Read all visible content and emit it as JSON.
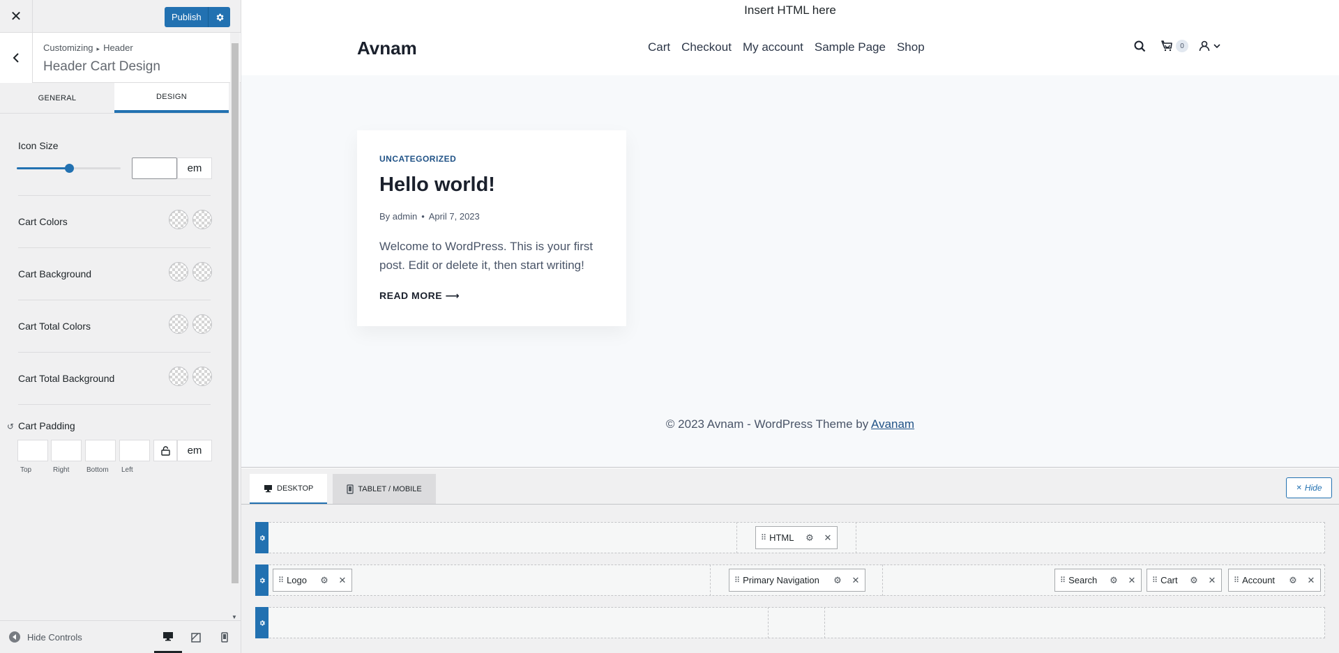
{
  "sidebar": {
    "publish_label": "Publish",
    "breadcrumb": {
      "root": "Customizing",
      "section": "Header"
    },
    "title": "Header Cart Design",
    "tabs": [
      {
        "label": "GENERAL"
      },
      {
        "label": "DESIGN"
      }
    ],
    "active_tab": "DESIGN",
    "icon_size": {
      "label": "Icon Size",
      "slider_fraction": 0.5,
      "value": "",
      "unit": "em"
    },
    "color_controls": [
      {
        "label": "Cart Colors"
      },
      {
        "label": "Cart Background"
      },
      {
        "label": "Cart Total Colors"
      },
      {
        "label": "Cart Total Background"
      }
    ],
    "padding": {
      "label": "Cart Padding",
      "unit": "em",
      "sides": [
        {
          "label": "Top"
        },
        {
          "label": "Right"
        },
        {
          "label": "Bottom"
        },
        {
          "label": "Left"
        }
      ]
    },
    "footer": {
      "hide_controls": "Hide Controls"
    }
  },
  "preview": {
    "top_html": "Insert HTML here",
    "logo": "Avnam",
    "nav": [
      "Cart",
      "Checkout",
      "My account",
      "Sample Page",
      "Shop"
    ],
    "cart_count": "0",
    "post": {
      "category": "UNCATEGORIZED",
      "title": "Hello world!",
      "author": "By admin",
      "date": "April 7, 2023",
      "excerpt": "Welcome to WordPress. This is your first post. Edit or delete it, then start writing!",
      "read_more": "READ MORE"
    },
    "footer": {
      "text": "© 2023 Avnam - WordPress Theme by ",
      "link": "Avanam"
    }
  },
  "builder": {
    "tabs": [
      {
        "label": "DESKTOP"
      },
      {
        "label": "TABLET / MOBILE"
      }
    ],
    "hide_label": "Hide",
    "items": {
      "html": "HTML",
      "logo": "Logo",
      "navigation": "Primary Navigation",
      "search": "Search",
      "cart": "Cart",
      "account": "Account"
    }
  },
  "colors": {
    "accent": "#2271b1",
    "link": "#215387"
  }
}
